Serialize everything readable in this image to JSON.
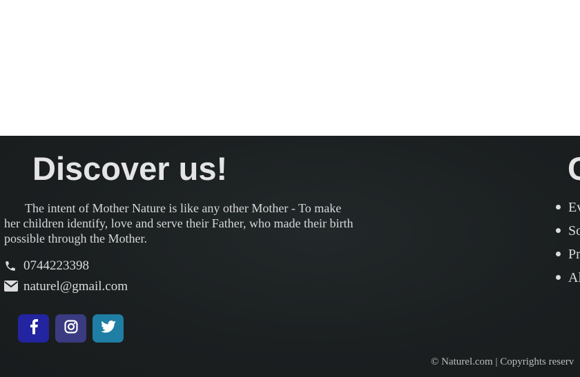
{
  "footer": {
    "title": "Discover us!",
    "intro": "The intent of Mother Nature is like any other Mother - To make her children identify, love and serve their Father, who made their birth possible through the Mother.",
    "contact": {
      "phone": "0744223398",
      "phone_icon": "phone-icon",
      "email": "naturel@gmail.com",
      "email_icon": "envelope-icon"
    },
    "social": [
      {
        "icon": "facebook-icon",
        "color": "#2324a0"
      },
      {
        "icon": "instagram-icon",
        "color": "#3a3b80"
      },
      {
        "icon": "twitter-icon",
        "color": "#1f7ea3"
      }
    ],
    "right_column": {
      "title_partial": "C",
      "items": [
        "Ev",
        "So",
        "Pr",
        "Al"
      ]
    },
    "copyright": "© Naturel.com | Copyrights reserv"
  },
  "colors": {
    "footer_bg": "#1b1f20",
    "text": "#e2e2e2"
  }
}
